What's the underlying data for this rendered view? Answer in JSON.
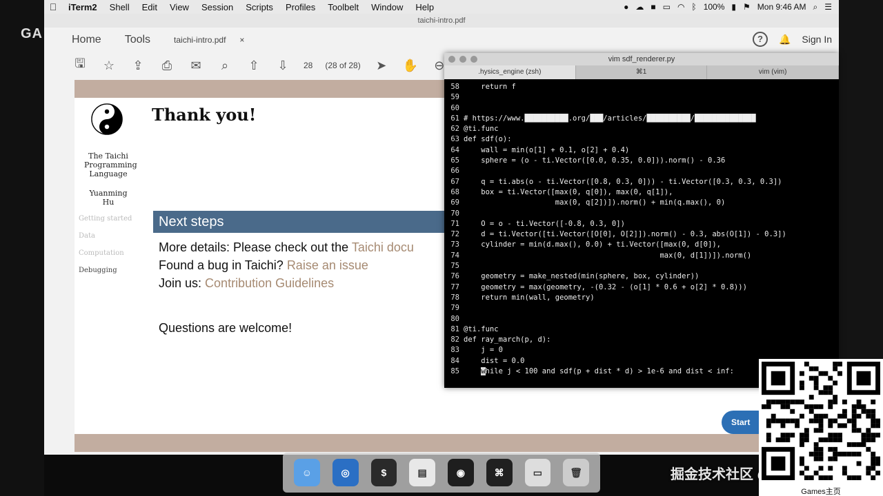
{
  "menubar": {
    "app_name": "iTerm2",
    "items": [
      "Shell",
      "Edit",
      "View",
      "Session",
      "Scripts",
      "Profiles",
      "Toolbelt",
      "Window",
      "Help"
    ],
    "battery": "100%",
    "clock": "Mon 9:46 AM"
  },
  "overlay": {
    "channel_label": "GA"
  },
  "acrobat": {
    "window_title": "taichi-intro.pdf",
    "tabs": {
      "home": "Home",
      "tools": "Tools",
      "file": "taichi-intro.pdf",
      "close": "×"
    },
    "help_label": "?",
    "signin": "Sign In",
    "page_num": "28",
    "page_count": "(28 of 28)"
  },
  "pdf": {
    "heading": "Thank you!",
    "sidebar_title": "The Taichi Programming Language",
    "author": "Yuanming Hu",
    "nav": [
      "Getting started",
      "Data",
      "Computation",
      "Debugging"
    ],
    "section": "Next steps",
    "lines": [
      {
        "prefix": "More details:  Please check out the ",
        "link": "Taichi docu"
      },
      {
        "prefix": "Found a bug in Taichi?  ",
        "link": "Raise an issue"
      },
      {
        "prefix": "Join us:  ",
        "link": "Contribution Guidelines"
      }
    ],
    "questions": "Questions are welcome!",
    "start_button": "Start"
  },
  "terminal": {
    "title": "vim sdf_renderer.py",
    "tabs": [
      ".hysics_engine (zsh)",
      "⌘1",
      "vim (vim)"
    ],
    "lines": [
      {
        "n": "58",
        "t": "    return f"
      },
      {
        "n": "59",
        "t": ""
      },
      {
        "n": "60",
        "t": ""
      },
      {
        "n": "61",
        "t": "# https://www.██████████.org/███/articles/██████████/██████████████"
      },
      {
        "n": "62",
        "t": "@ti.func"
      },
      {
        "n": "63",
        "t": "def sdf(o):"
      },
      {
        "n": "64",
        "t": "    wall = min(o[1] + 0.1, o[2] + 0.4)"
      },
      {
        "n": "65",
        "t": "    sphere = (o - ti.Vector([0.0, 0.35, 0.0])).norm() - 0.36"
      },
      {
        "n": "66",
        "t": ""
      },
      {
        "n": "67",
        "t": "    q = ti.abs(o - ti.Vector([0.8, 0.3, 0])) - ti.Vector([0.3, 0.3, 0.3])"
      },
      {
        "n": "68",
        "t": "    box = ti.Vector([max(0, q[0]), max(0, q[1]),"
      },
      {
        "n": "69",
        "t": "                     max(0, q[2])]).norm() + min(q.max(), 0)"
      },
      {
        "n": "70",
        "t": ""
      },
      {
        "n": "71",
        "t": "    O = o - ti.Vector([-0.8, 0.3, 0])"
      },
      {
        "n": "72",
        "t": "    d = ti.Vector([ti.Vector([O[0], O[2]]).norm() - 0.3, abs(O[1]) - 0.3])"
      },
      {
        "n": "73",
        "t": "    cylinder = min(d.max(), 0.0) + ti.Vector([max(0, d[0]),"
      },
      {
        "n": "74",
        "t": "                                             max(0, d[1])]).norm()"
      },
      {
        "n": "75",
        "t": ""
      },
      {
        "n": "76",
        "t": "    geometry = make_nested(min(sphere, box, cylinder))"
      },
      {
        "n": "77",
        "t": "    geometry = max(geometry, -(0.32 - (o[1] * 0.6 + o[2] * 0.8)))"
      },
      {
        "n": "78",
        "t": "    return min(wall, geometry)"
      },
      {
        "n": "79",
        "t": ""
      },
      {
        "n": "80",
        "t": ""
      },
      {
        "n": "81",
        "t": "@ti.func"
      },
      {
        "n": "82",
        "t": "def ray_march(p, d):"
      },
      {
        "n": "83",
        "t": "    j = 0"
      },
      {
        "n": "84",
        "t": "    dist = 0.0"
      },
      {
        "n": "85",
        "t": "    while j < 100 and sdf(p + dist * d) > 1e-6 and dist < inf:"
      }
    ]
  },
  "dock": {
    "apps": [
      {
        "name": "Finder",
        "icon": "finder-icon",
        "color": "#5aa0e6"
      },
      {
        "name": "Safari",
        "icon": "safari-icon",
        "color": "#2b6fc4"
      },
      {
        "name": "Terminal",
        "icon": "terminal-icon",
        "color": "#2a2a2a"
      },
      {
        "name": "Keynote",
        "icon": "keynote-icon",
        "color": "#e8e8e8"
      },
      {
        "name": "OBS",
        "icon": "obs-icon",
        "color": "#1e1e1e"
      },
      {
        "name": "Acrobat",
        "icon": "acrobat-icon",
        "color": "#202020"
      },
      {
        "name": "Preview",
        "icon": "preview-icon",
        "color": "#ddd"
      },
      {
        "name": "Trash",
        "icon": "trash-icon",
        "color": "#ccc"
      }
    ]
  },
  "watermark": "掘金技术社区 @ 布客飞龙",
  "qr_label": "Games主页"
}
